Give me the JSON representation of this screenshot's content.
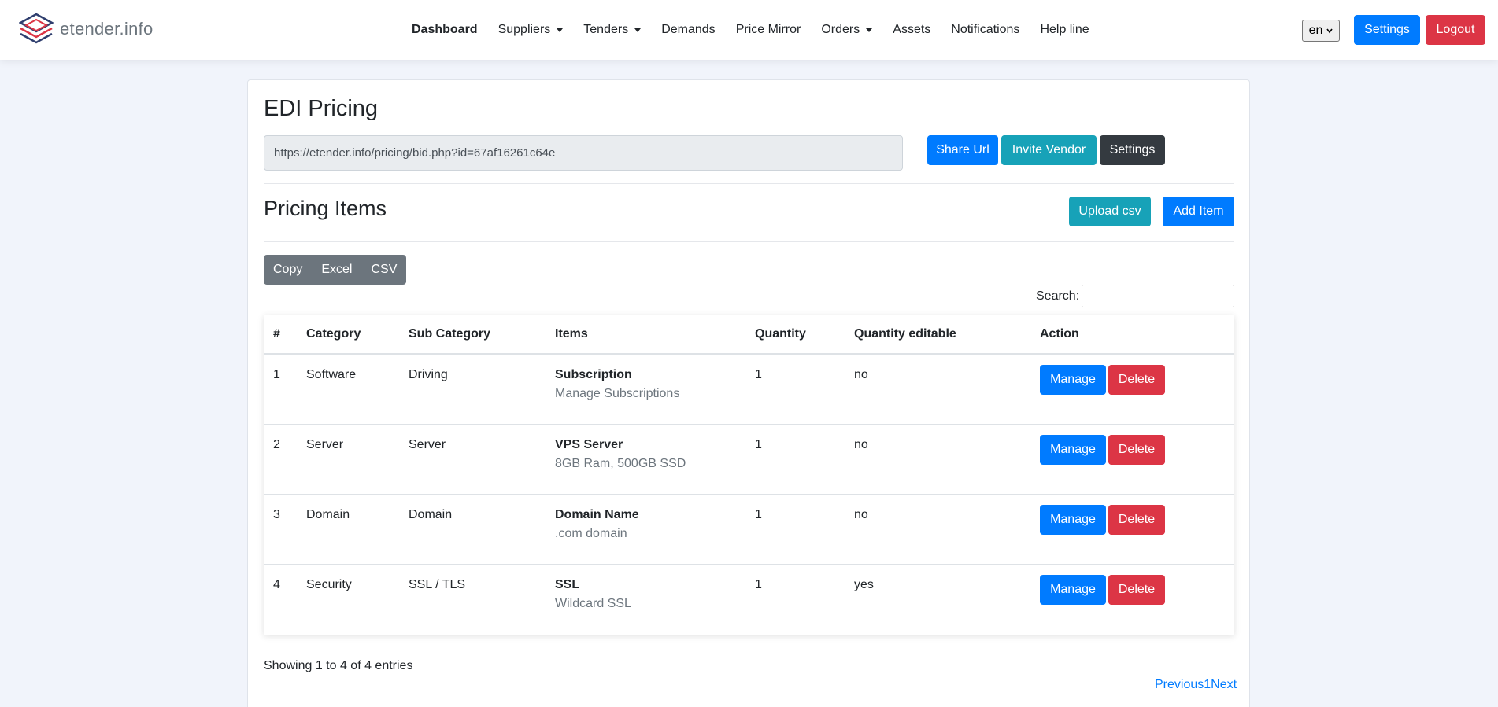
{
  "brand": {
    "name": "etender.info",
    "icon": "etender-logo-icon"
  },
  "nav": {
    "items": [
      {
        "label": "Dashboard",
        "active": true,
        "dropdown": false
      },
      {
        "label": "Suppliers",
        "active": false,
        "dropdown": true
      },
      {
        "label": "Tenders",
        "active": false,
        "dropdown": true
      },
      {
        "label": "Demands",
        "active": false,
        "dropdown": false
      },
      {
        "label": "Price Mirror",
        "active": false,
        "dropdown": false
      },
      {
        "label": "Orders",
        "active": false,
        "dropdown": true
      },
      {
        "label": "Assets",
        "active": false,
        "dropdown": false
      },
      {
        "label": "Notifications",
        "active": false,
        "dropdown": false
      },
      {
        "label": "Help line",
        "active": false,
        "dropdown": false
      }
    ],
    "language": "en",
    "settings_label": "Settings",
    "logout_label": "Logout"
  },
  "page": {
    "title": "EDI Pricing",
    "share_url": "https://etender.info/pricing/bid.php?id=67af16261c64e",
    "share_label": "Share Url",
    "invite_label": "Invite Vendor",
    "settings_label": "Settings"
  },
  "pricing": {
    "title": "Pricing Items",
    "upload_label": "Upload csv",
    "add_label": "Add Item",
    "export_buttons": [
      "Copy",
      "Excel",
      "CSV"
    ],
    "search_label": "Search:",
    "search_value": "",
    "columns": [
      "#",
      "Category",
      "Sub Category",
      "Items",
      "Quantity",
      "Quantity editable",
      "Action"
    ],
    "rows": [
      {
        "num": "1",
        "category": "Software",
        "subcategory": "Driving",
        "item": "Subscription",
        "description": "Manage Subscriptions",
        "quantity": "1",
        "editable": "no"
      },
      {
        "num": "2",
        "category": "Server",
        "subcategory": "Server",
        "item": "VPS Server",
        "description": "8GB Ram, 500GB SSD",
        "quantity": "1",
        "editable": "no"
      },
      {
        "num": "3",
        "category": "Domain",
        "subcategory": "Domain",
        "item": "Domain Name",
        "description": ".com domain",
        "quantity": "1",
        "editable": "no"
      },
      {
        "num": "4",
        "category": "Security",
        "subcategory": "SSL / TLS",
        "item": "SSL",
        "description": "Wildcard SSL",
        "quantity": "1",
        "editable": "yes"
      }
    ],
    "manage_label": "Manage",
    "delete_label": "Delete",
    "info": "Showing 1 to 4 of 4 entries",
    "pager": {
      "previous": "Previous",
      "page": "1",
      "next": "Next"
    }
  },
  "colors": {
    "primary": "#007bff",
    "danger": "#dc3545",
    "info": "#17a2b8",
    "dark": "#343a40",
    "secondary": "#6c757d"
  }
}
